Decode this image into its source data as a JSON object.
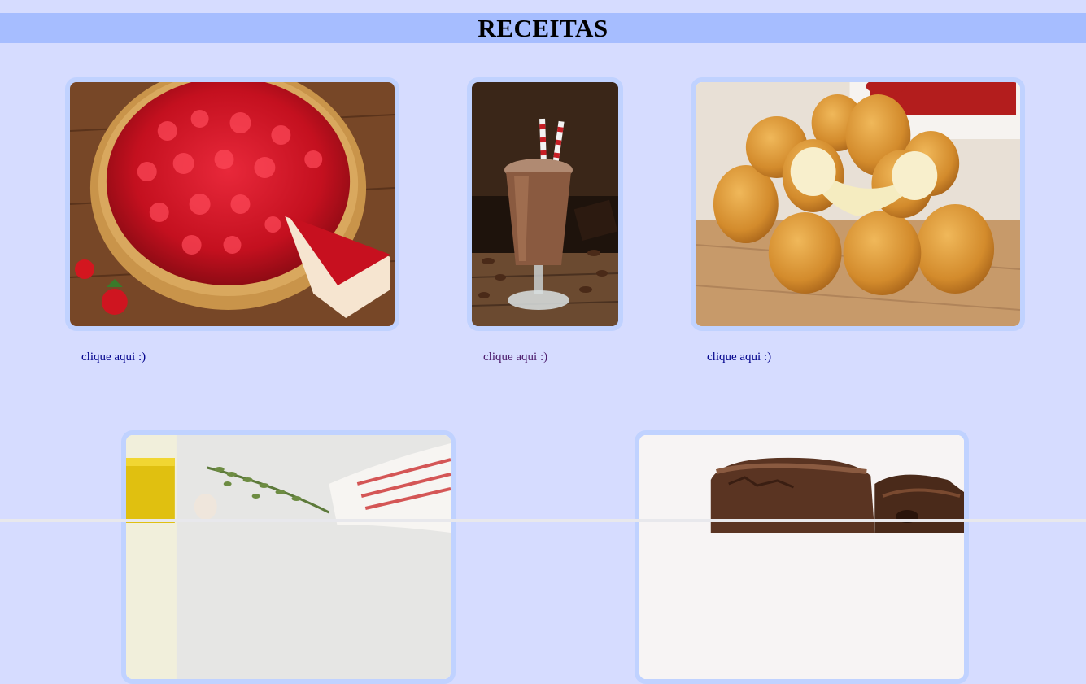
{
  "page": {
    "title": "RECEITAS"
  },
  "cards": [
    {
      "image": "strawberry-pie-image",
      "link_label": "clique aqui :)"
    },
    {
      "image": "chocolate-milkshake-image",
      "link_label": "clique aqui :)"
    },
    {
      "image": "cheese-croquettes-image",
      "link_label": "clique aqui :)"
    },
    {
      "image": "olive-oil-herbs-image"
    },
    {
      "image": "brownie-image"
    }
  ],
  "colors": {
    "background": "#d6dcff",
    "header_band": "#a6bdff",
    "card_border": "#c0d2ff",
    "link": "#00008b",
    "link_visited": "#4b1a6b"
  }
}
